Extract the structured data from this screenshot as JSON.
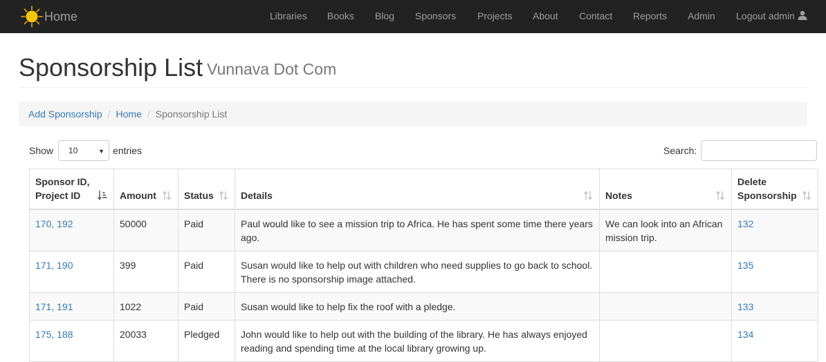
{
  "nav": {
    "brand": "Home",
    "items": [
      "Libraries",
      "Books",
      "Blog",
      "Sponsors",
      "Projects",
      "About",
      "Contact",
      "Reports",
      "Admin"
    ],
    "logout": "Logout admin"
  },
  "header": {
    "title": "Sponsorship List",
    "subtitle": "Vunnava Dot Com"
  },
  "breadcrumb": {
    "add": "Add Sponsorship",
    "sep": "/",
    "home": "Home",
    "current": "Sponsorship List"
  },
  "controls": {
    "show": "Show",
    "page_size": "10",
    "entries": "entries",
    "search": "Search:"
  },
  "table": {
    "columns": [
      {
        "line1": "Sponsor ID,",
        "line2": "Project ID"
      },
      {
        "line1": "Amount",
        "line2": ""
      },
      {
        "line1": "Status",
        "line2": ""
      },
      {
        "line1": "Details",
        "line2": ""
      },
      {
        "line1": "Notes",
        "line2": ""
      },
      {
        "line1": "Delete",
        "line2": "Sponsorship"
      }
    ],
    "rows": [
      {
        "ids": "170, 192",
        "amount": "50000",
        "status": "Paid",
        "details": "Paul would like to see a mission trip to Africa. He has spent some time there years ago.",
        "notes": "We can look into an African mission trip.",
        "delete": "132"
      },
      {
        "ids": "171, 190",
        "amount": "399",
        "status": "Paid",
        "details": "Susan would like to help out with children who need supplies to go back to school. There is no sponsorship image attached.",
        "notes": "",
        "delete": "135"
      },
      {
        "ids": "171, 191",
        "amount": "1022",
        "status": "Paid",
        "details": "Susan would like to help fix the roof with a pledge.",
        "notes": "",
        "delete": "133"
      },
      {
        "ids": "175, 188",
        "amount": "20033",
        "status": "Pledged",
        "details": "John would like to help out with the building of the library. He has always enjoyed reading and spending time at the local library growing up.",
        "notes": "",
        "delete": "134"
      }
    ]
  },
  "colors": {
    "navbar": "#222222",
    "nav_text": "#9d9d9d",
    "link": "#337ab7",
    "sun": "#f7c600"
  }
}
